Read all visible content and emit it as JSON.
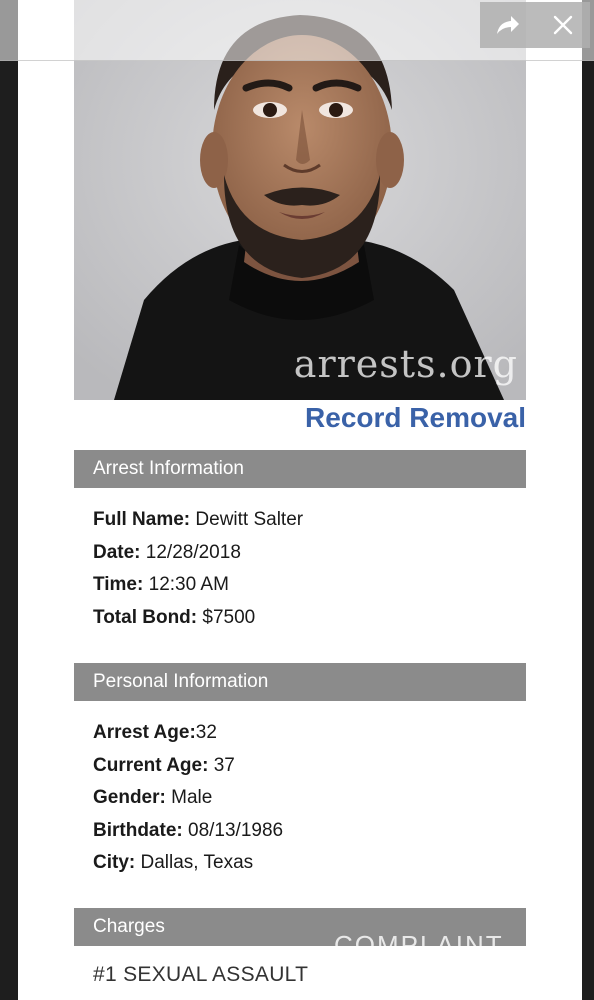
{
  "toolbar": {
    "share_icon": "share-arrow-icon",
    "close_icon": "close-icon"
  },
  "photo": {
    "watermark": "arrests.org"
  },
  "record_removal_link": "Record Removal",
  "arrest_info": {
    "header": "Arrest Information",
    "rows": [
      {
        "label": "Full Name:",
        "value": " Dewitt Salter"
      },
      {
        "label": "Date:",
        "value": " 12/28/2018"
      },
      {
        "label": "Time:",
        "value": " 12:30 AM"
      },
      {
        "label": "Total Bond:",
        "value": " $7500"
      }
    ]
  },
  "personal_info": {
    "header": "Personal Information",
    "rows": [
      {
        "label": "Arrest Age:",
        "value": "32"
      },
      {
        "label": "Current Age:",
        "value": " 37"
      },
      {
        "label": "Gender:",
        "value": " Male"
      },
      {
        "label": "Birthdate:",
        "value": " 08/13/1986"
      },
      {
        "label": "City:",
        "value": " Dallas, Texas"
      }
    ]
  },
  "charges": {
    "header": "Charges",
    "items": [
      "#1 SEXUAL ASSAULT"
    ]
  },
  "overlay_watermark": "COMPLAINT",
  "colors": {
    "link_blue": "#3a62a8",
    "header_gray": "#8b8b8b",
    "frame_dark": "#1e1e1e"
  }
}
